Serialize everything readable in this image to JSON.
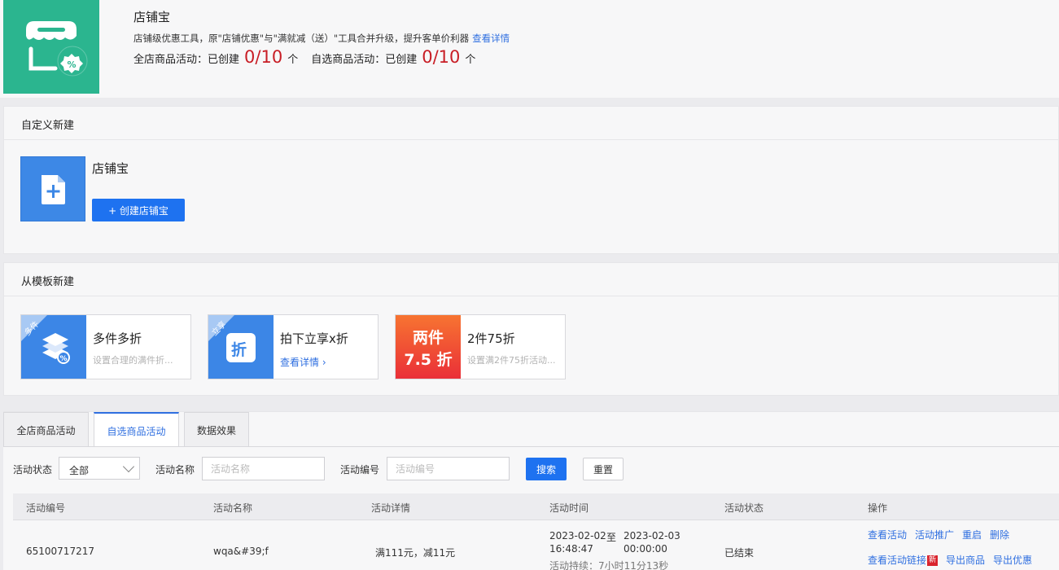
{
  "header": {
    "title": "店铺宝",
    "desc": "店铺级优惠工具，原\"店铺优惠\"与\"满就减（送）\"工具合并升级，提升客单价利器",
    "desc_link": "查看详情",
    "stat1_label": "全店商品活动：已创建",
    "stat1_value": "0/10",
    "stat1_unit": "个",
    "stat2_label": "自选商品活动：已创建",
    "stat2_value": "0/10",
    "stat2_unit": "个"
  },
  "custom": {
    "heading": "自定义新建",
    "card_title": "店铺宝",
    "create_label": "+ 创建店铺宝"
  },
  "templates": {
    "heading": "从模板新建",
    "cards": [
      {
        "ribbon": "多件",
        "title": "多件多折",
        "sub": "设置合理的满件折..."
      },
      {
        "ribbon": "立享",
        "icon_char": "折",
        "title": "拍下立享x折",
        "link": "查看详情"
      },
      {
        "badge_line1": "两件",
        "badge_line2": "7.5 折",
        "title": "2件75折",
        "sub": "设置满2件75折活动..."
      }
    ]
  },
  "tabs": [
    {
      "label": "全店商品活动"
    },
    {
      "label": "自选商品活动"
    },
    {
      "label": "数据效果"
    }
  ],
  "filters": {
    "status_label": "活动状态",
    "status_value": "全部",
    "name_label": "活动名称",
    "name_placeholder": "活动名称",
    "id_label": "活动编号",
    "id_placeholder": "活动编号",
    "search_label": "搜索",
    "reset_label": "重置"
  },
  "table": {
    "columns": [
      "活动编号",
      "活动名称",
      "活动详情",
      "活动时间",
      "活动状态",
      "操作"
    ],
    "rows": [
      {
        "id": "65100717217",
        "name": "wqa&#39;f",
        "detail": "满111元，减11元",
        "start_date": "2023-02-02",
        "start_time": "16:48:47",
        "to": "至",
        "end_date": "2023-02-03",
        "end_time": "00:00:00",
        "duration": "活动持续：7小时11分13秒",
        "status": "已结束",
        "actions": [
          "查看活动",
          "活动推广",
          "重启",
          "删除"
        ],
        "actions2": [
          "查看活动链接",
          "导出商品",
          "导出优惠"
        ],
        "new_badge": "新"
      }
    ]
  },
  "colors": {
    "accent": "#1e72f0",
    "link": "#2f6fe0",
    "logo_bg": "#2bb58f",
    "stat_red": "#c81d25"
  }
}
